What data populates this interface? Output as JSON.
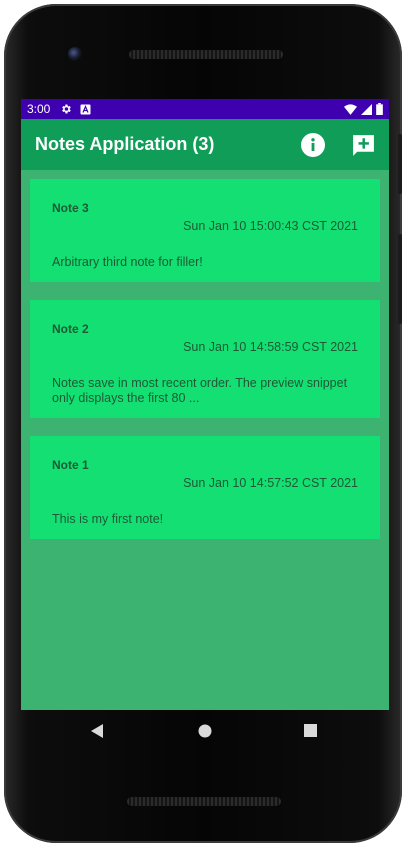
{
  "status_bar": {
    "time": "3:00",
    "left_icons": [
      "settings-icon",
      "a-icon"
    ],
    "right_icons": [
      "wifi-icon",
      "signal-icon",
      "battery-icon"
    ],
    "background": "#3f00b0"
  },
  "app_bar": {
    "title": "Notes Application (3)",
    "actions": [
      "info-icon",
      "add-note-icon"
    ],
    "background": "#0f9d58"
  },
  "notes": [
    {
      "title": "Note 3",
      "date": "Sun Jan 10 15:00:43 CST 2021",
      "body": "Arbitrary third note for filler!"
    },
    {
      "title": "Note 2",
      "date": "Sun Jan 10 14:58:59 CST 2021",
      "body": "Notes save in most recent order. The preview snippet only displays the first 80 ..."
    },
    {
      "title": "Note 1",
      "date": "Sun Jan 10 14:57:52 CST 2021",
      "body": "This is my first note!"
    }
  ],
  "colors": {
    "screen_background": "#3cb371",
    "card_background": "#13df73",
    "card_text": "#1d5a35"
  },
  "nav_bar": {
    "buttons": [
      "back-icon",
      "home-icon",
      "recents-icon"
    ]
  }
}
